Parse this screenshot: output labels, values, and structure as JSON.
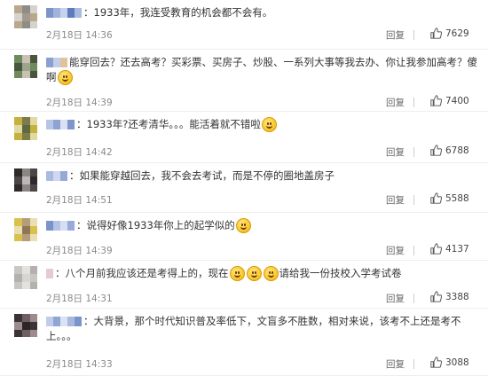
{
  "comments": [
    {
      "text": "：1933年，我连受教育的机会都不会有。",
      "time": "2月18日 14:36",
      "reply": "回复",
      "likes": "7629",
      "emoji": 0,
      "avatar_colors": [
        "#b9a88c",
        "#8e8c86",
        "#d6d3ce",
        "#a39a8b"
      ],
      "name_colors": [
        "#7d94c9",
        "#9fb3dc",
        "#c7d3ec",
        "#5f7bbf",
        "#aabbe0"
      ]
    },
    {
      "text": "能穿回去？还去高考？买彩票、买房子、炒股、一系列大事等我去办、你让我参加高考？傻啊",
      "time": "2月18日 14:39",
      "reply": "回复",
      "likes": "7400",
      "emoji": 1,
      "avatar_colors": [
        "#6f8b5e",
        "#c9c2b4",
        "#48563d",
        "#9aa58a"
      ],
      "name_colors": [
        "#8aa0d0",
        "#c3cfea",
        "#e0c39c"
      ]
    },
    {
      "text": "：1933年?还考清华。。。能活着就不错啦",
      "time": "2月18日 14:42",
      "reply": "回复",
      "likes": "6788",
      "emoji": 1,
      "avatar_colors": [
        "#c5b23e",
        "#7e7a4a",
        "#e1d9a3",
        "#5d6a40"
      ],
      "name_colors": [
        "#b6c4e6",
        "#8ea3d3",
        "#d9e1f2",
        "#7f96cc"
      ]
    },
    {
      "text": "：如果能穿越回去，我不会去考试，而是不停的圈地盖房子",
      "time": "2月18日 14:51",
      "reply": "回复",
      "likes": "5588",
      "emoji": 0,
      "avatar_colors": [
        "#2e2a2a",
        "#8c8585",
        "#4d4646",
        "#bfb7b7"
      ],
      "name_colors": [
        "#aab9df",
        "#cfd8ee",
        "#95a9d6"
      ]
    },
    {
      "text": "：说得好像1933年你上的起学似的",
      "time": "2月18日 14:39",
      "reply": "回复",
      "likes": "4137",
      "emoji": 1,
      "avatar_colors": [
        "#d8c24b",
        "#b49d7a",
        "#eadfb3",
        "#8d7757"
      ],
      "name_colors": [
        "#7b93cb",
        "#b3c2e5",
        "#d6dff1",
        "#98abd8"
      ]
    },
    {
      "text": "：八个月前我应该还是考得上的，现在",
      "text_after": "请给我一份技校入学考试卷",
      "time": "2月18日 14:31",
      "reply": "回复",
      "likes": "3388",
      "emoji": 3,
      "avatar_colors": [
        "#c9c7c4",
        "#e4e2df",
        "#b3b0ad",
        "#d7d5d2"
      ],
      "name_colors": [
        "#e7c9d2"
      ]
    },
    {
      "text": "：大背景，那个时代知识普及率低下，文盲多不胜数，相对来说，该考不上还是考不上。。。",
      "time": "2月18日 14:33",
      "reply": "回复",
      "likes": "3088",
      "emoji": 0,
      "avatar_colors": [
        "#3a3436",
        "#6f5f62",
        "#9d8b8f",
        "#2a2527"
      ],
      "name_colors": [
        "#c0cdea",
        "#8fa5d5",
        "#dbe3f3",
        "#a8b9e0",
        "#7c94cb"
      ]
    }
  ]
}
